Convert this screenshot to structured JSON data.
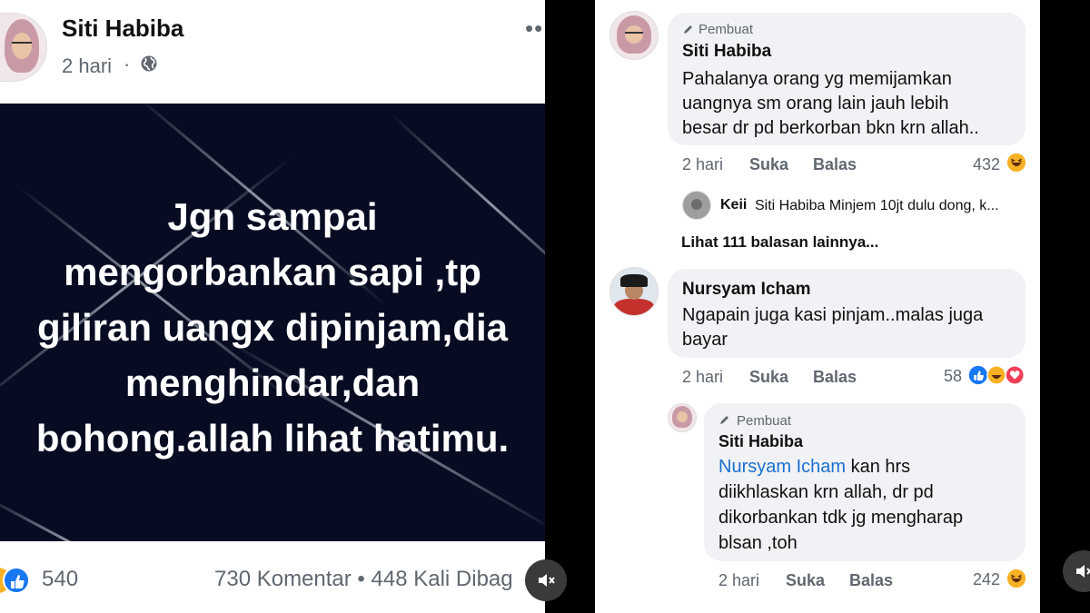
{
  "post": {
    "author": "Siti Habiba",
    "time": "2 hari",
    "more_icon": "ellipsis-icon",
    "image_lines": [
      "Jgn sampai",
      "mengorbankan  sapi ,tp",
      "giliran uangx dipinjam,dia",
      "menghindar,dan",
      "bohong.allah lihat hatimu."
    ],
    "reaction_count": "540",
    "stats": "730 Komentar • 448 Kali Dibag"
  },
  "comments": [
    {
      "author_tag": "Pembuat",
      "name": "Siti Habiba",
      "lines": [
        "Pahalanya orang yg memijamkan",
        "uangnya sm orang lain jauh lebih",
        "besar dr pd berkorban bkn krn allah.."
      ],
      "time": "2 hari",
      "like": "Suka",
      "reply": "Balas",
      "reactions": "432"
    },
    {
      "name": "Nursyam Icham",
      "lines": [
        "Ngapain juga kasi pinjam..malas juga",
        "bayar"
      ],
      "time": "2 hari",
      "like": "Suka",
      "reply": "Balas",
      "reactions": "58"
    }
  ],
  "reply_preview": {
    "name": "Keii",
    "text": "Siti Habiba Minjem 10jt dulu dong, k..."
  },
  "more_replies": "Lihat 111 balasan lainnya...",
  "nested_reply": {
    "author_tag": "Pembuat",
    "name": "Siti Habiba",
    "mention": "Nursyam Icham",
    "line1_rest": " kan hrs",
    "lines": [
      "diikhlaskan krn allah, dr pd",
      "dikorbankan tdk jg mengharap",
      "blsan ,toh"
    ],
    "time": "2 hari",
    "like": "Suka",
    "reply": "Balas",
    "reactions": "242"
  },
  "colors": {
    "like_blue": "#1877f2",
    "haha_yellow": "#f7b125",
    "love_red": "#f33e58",
    "mention_blue": "#1a6fd1"
  }
}
